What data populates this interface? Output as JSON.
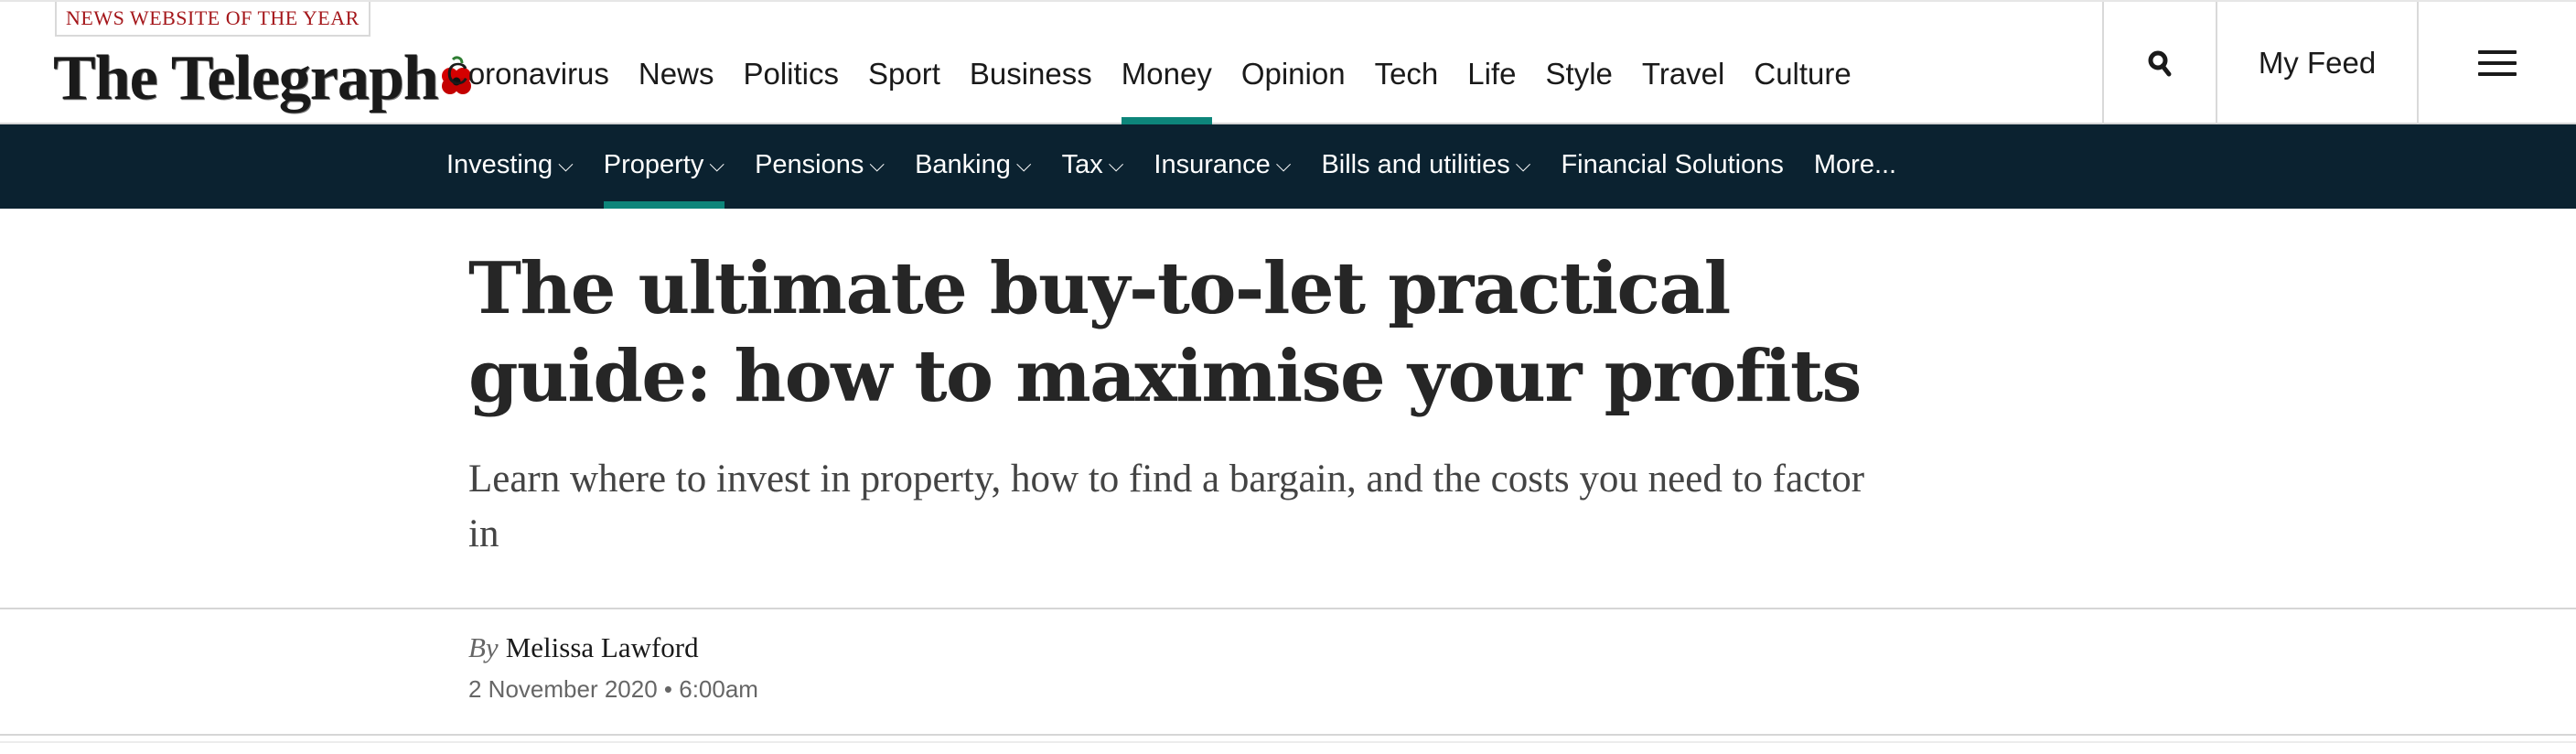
{
  "masthead": {
    "award": "NEWS WEBSITE OF THE YEAR",
    "logo": "The Telegraph",
    "nav": [
      "Coronavirus",
      "News",
      "Politics",
      "Sport",
      "Business",
      "Money",
      "Opinion",
      "Tech",
      "Life",
      "Style",
      "Travel",
      "Culture"
    ],
    "active_nav": "Money",
    "my_feed": "My Feed",
    "icons": {
      "search": "search-icon",
      "menu": "hamburger-menu-icon",
      "poppy": "poppy-icon"
    }
  },
  "subnav": {
    "items": [
      {
        "label": "Investing",
        "dropdown": true
      },
      {
        "label": "Property",
        "dropdown": true,
        "active": true
      },
      {
        "label": "Pensions",
        "dropdown": true
      },
      {
        "label": "Banking",
        "dropdown": true
      },
      {
        "label": "Tax",
        "dropdown": true
      },
      {
        "label": "Insurance",
        "dropdown": true
      },
      {
        "label": "Bills and utilities",
        "dropdown": true
      },
      {
        "label": "Financial Solutions",
        "dropdown": false
      },
      {
        "label": "More...",
        "dropdown": false
      }
    ],
    "chevron": "⌵"
  },
  "article": {
    "headline": "The ultimate buy-to-let practical guide: how to maximise your profits",
    "standfirst": "Learn where to invest in property, how to find a bargain, and the costs you need to factor in",
    "by_label": "By",
    "author": "Melissa Lawford",
    "date": "2 November 2020 • 6:00am"
  },
  "colors": {
    "accent": "#0d857a",
    "subnav_bg": "#0b2230",
    "award_red": "#a4161a"
  }
}
